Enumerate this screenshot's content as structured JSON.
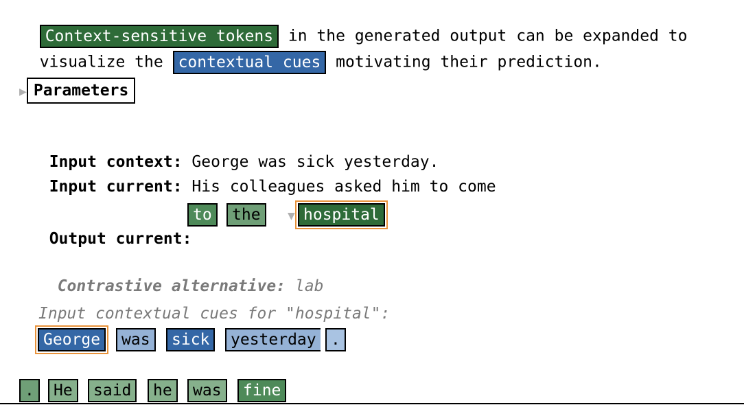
{
  "intro": {
    "token1": "Context-sensitive tokens",
    "text1": " in the generated output can be expanded to",
    "text2a": "visualize the ",
    "token2": "contextual cues",
    "text2b": " motivating their prediction."
  },
  "parameters": {
    "toggle_icon": "triangle-right-icon",
    "label": "Parameters"
  },
  "input": {
    "context_label": "Input context:",
    "context_value": " George was sick yesterday.",
    "current_label": "Input current:",
    "current_value": " His colleagues asked him to come"
  },
  "output": {
    "label": "Output current:",
    "tokens": [
      "to",
      "the",
      "hospital"
    ],
    "expand_icon": "triangle-down-icon"
  },
  "contrastive": {
    "label": "Contrastive alternative:",
    "value": " lab"
  },
  "cues": {
    "label": "Input contextual cues for \"hospital\":",
    "tokens": [
      "George",
      "was",
      "sick",
      "yesterday",
      "."
    ]
  },
  "continuation": {
    "tokens": [
      ".",
      "He",
      "said",
      "he",
      "was",
      "fine"
    ]
  },
  "colors": {
    "green_dark": "#2e6b38",
    "blue_dark": "#3467a6",
    "highlight_orange": "#e8923a"
  }
}
